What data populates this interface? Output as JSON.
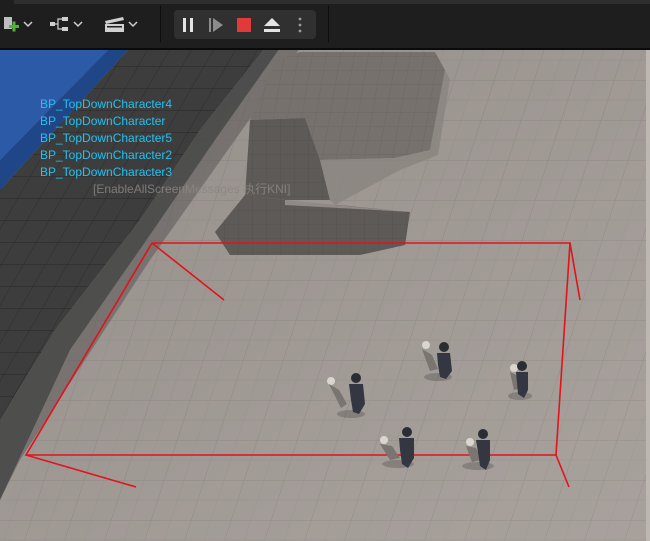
{
  "toolbar": {
    "add_icon": "add-actor-icon",
    "blueprint_icon": "blueprint-graph-icon",
    "cinematics_icon": "clapperboard-icon",
    "play": {
      "pause_icon": "pause-icon",
      "step_icon": "frame-skip-icon",
      "stop_icon": "stop-icon",
      "eject_icon": "eject-icon",
      "more_icon": "more-vertical-icon",
      "stop_color": "#e03a3a"
    }
  },
  "viewport": {
    "debug_lines": [
      "BP_TopDownCharacter4",
      "BP_TopDownCharacter",
      "BP_TopDownCharacter5",
      "BP_TopDownCharacter2",
      "BP_TopDownCharacter3"
    ],
    "ghost_message": "[EnableAllScreenMessages 执行KNI]",
    "debug_text_color": "#25c0f0",
    "selection_box_color": "#e3121b",
    "cube_color": "#1e7bff"
  }
}
